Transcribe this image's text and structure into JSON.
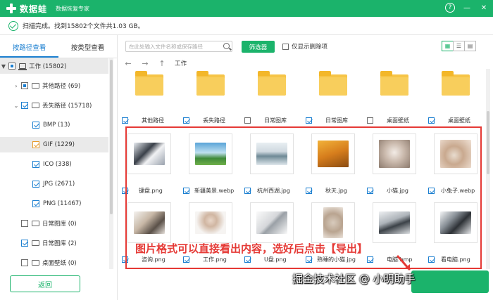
{
  "app": {
    "name": "数据蛙",
    "subtitle": "数据恢复专家"
  },
  "status": {
    "text": "扫描完成。找到15802个文件共1.03 GB。"
  },
  "tabs": [
    {
      "label": "按路径查看"
    },
    {
      "label": "按类型查看"
    }
  ],
  "tree": [
    {
      "label": "工作 (15802)"
    },
    {
      "label": "其他路径 (69)"
    },
    {
      "label": "丢失路径 (15718)"
    },
    {
      "label": "BMP (13)"
    },
    {
      "label": "GIF (1229)"
    },
    {
      "label": "ICO (338)"
    },
    {
      "label": "JPG (2671)"
    },
    {
      "label": "PNG (11467)"
    },
    {
      "label": "日常图库 (0)"
    },
    {
      "label": "日常图库 (2)"
    },
    {
      "label": "桌面壁纸 (0)"
    }
  ],
  "toolbar": {
    "search_placeholder": "在此处输入文件名称或保存路径",
    "filter_label": "筛选器",
    "only_deleted_label": "仅显示删除项"
  },
  "nav": {
    "path": "工作"
  },
  "folders": [
    {
      "label": "其他路径"
    },
    {
      "label": "丢失路径"
    },
    {
      "label": "日常图库"
    },
    {
      "label": "日常图库"
    },
    {
      "label": "桌面壁纸"
    },
    {
      "label": "桌面壁纸"
    }
  ],
  "files_row1": [
    {
      "label": "键盘.png"
    },
    {
      "label": "新疆美景.webp"
    },
    {
      "label": "杭州西湖.jpg"
    },
    {
      "label": "秋天.jpg"
    },
    {
      "label": "小猫.jpg"
    },
    {
      "label": "小兔子.webp"
    }
  ],
  "files_row2": [
    {
      "label": "咨询.png"
    },
    {
      "label": "工作.png"
    },
    {
      "label": "U盘.png"
    },
    {
      "label": "熟睡的小猫.jpg"
    },
    {
      "label": "电脑.bmp"
    },
    {
      "label": "看电脑.png"
    }
  ],
  "annotation": "图片格式可以直接看出内容，选好后点击【导出】",
  "watermark": "掘金技术社区 @ 小明助手",
  "back_label": "返回",
  "colors": {
    "accent": "#1bb36b",
    "annotation": "#e53935",
    "folder": "#f6c447"
  }
}
